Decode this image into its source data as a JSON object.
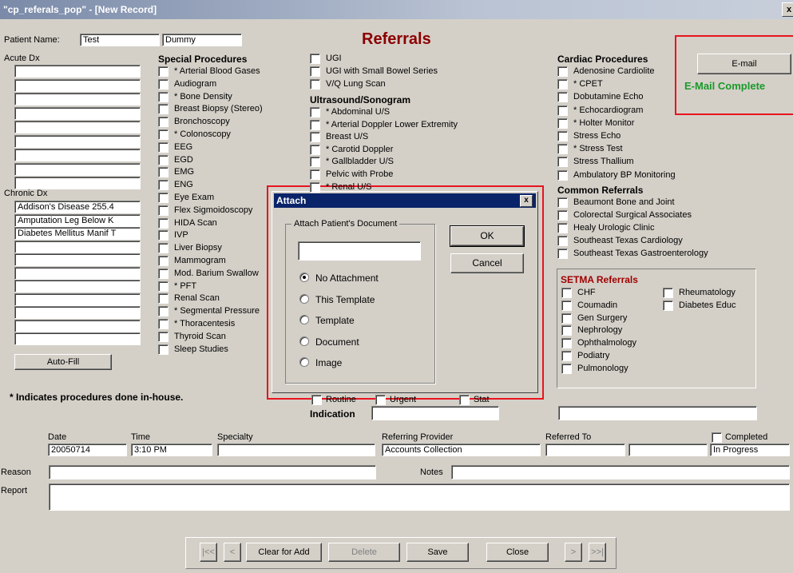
{
  "window": {
    "title": "\"cp_referals_pop\" - [New Record]",
    "close_glyph": "x"
  },
  "form_title": "Referrals",
  "patient": {
    "label": "Patient Name:",
    "first": "Test",
    "last": "Dummy"
  },
  "acute_dx": {
    "label": "Acute Dx",
    "values": [
      "",
      "",
      "",
      "",
      "",
      "",
      "",
      "",
      ""
    ]
  },
  "chronic_dx": {
    "label": "Chronic Dx",
    "values": [
      "Addison's Disease  255.4",
      "Amputation Leg Below K",
      "Diabetes Mellitus Manif T",
      "",
      "",
      "",
      "",
      "",
      "",
      "",
      ""
    ]
  },
  "autofill_label": "Auto-Fill",
  "inhouse_note": "* Indicates procedures done in-house.",
  "special_procedures": {
    "title": "Special Procedures",
    "items": [
      "* Arterial Blood Gases",
      "Audiogram",
      "* Bone Density",
      "Breast Biopsy (Stereo)",
      "Bronchoscopy",
      "* Colonoscopy",
      "EEG",
      "EGD",
      "EMG",
      "ENG",
      "Eye Exam",
      "Flex Sigmoidoscopy",
      "HIDA Scan",
      "IVP",
      "Liver Biopsy",
      "Mammogram",
      "Mod. Barium Swallow",
      "* PFT",
      "Renal Scan",
      "* Segmental Pressure",
      "* Thoracentesis",
      "Thyroid Scan",
      "Sleep Studies"
    ]
  },
  "gi": {
    "items": [
      "UGI",
      "UGI with Small Bowel Series",
      "V/Q Lung Scan"
    ]
  },
  "ultrasound": {
    "title": "Ultrasound/Sonogram",
    "items": [
      "* Abdominal U/S",
      "* Arterial Doppler Lower Extremity",
      "Breast U/S",
      "* Carotid Doppler",
      "* Gallbladder U/S",
      "Pelvic with Probe",
      "* Renal U/S"
    ]
  },
  "cardiac": {
    "title": "Cardiac Procedures",
    "items": [
      "Adenosine Cardiolite",
      "* CPET",
      "Dobutamine Echo",
      "* Echocardiogram",
      "* Holter Monitor",
      "Stress Echo",
      "* Stress Test",
      "Stress Thallium",
      "Ambulatory BP Monitoring"
    ]
  },
  "common": {
    "title": "Common Referrals",
    "items": [
      "Beaumont Bone and Joint",
      "Colorectal Surgical Associates",
      "Healy Urologic Clinic",
      "Southeast Texas Cardiology",
      "Southeast Texas Gastroenterology"
    ]
  },
  "setma": {
    "title": "SETMA Referrals",
    "left": [
      "CHF",
      "Coumadin",
      "Gen Surgery",
      "Nephrology",
      "Ophthalmology",
      "Podiatry",
      "Pulmonology"
    ],
    "right": [
      "Rheumatology",
      "Diabetes Educ"
    ]
  },
  "email": {
    "button": "E-mail",
    "status": "E-Mail Complete"
  },
  "priority": {
    "items": [
      "Routine",
      "Urgent",
      "Stat"
    ]
  },
  "indication": {
    "label": "Indication",
    "value": "",
    "extra_value": ""
  },
  "record": {
    "date_label": "Date",
    "date": "20050714",
    "time_label": "Time",
    "time": "3:10 PM",
    "specialty_label": "Specialty",
    "specialty": "",
    "provider_label": "Referring Provider",
    "provider": "Accounts Collection",
    "referred_label": "Referred To",
    "referred": "",
    "referred2": "",
    "completed_label": "Completed",
    "status": "In Progress",
    "reason_label": "Reason",
    "reason": "",
    "notes_label": "Notes",
    "notes": "",
    "report_label": "Report",
    "report": ""
  },
  "nav": {
    "first": "|<<",
    "prev": "<",
    "clear": "Clear for Add",
    "delete": "Delete",
    "save": "Save",
    "close": "Close",
    "next": ">",
    "last": ">>|"
  },
  "dialog": {
    "title": "Attach",
    "close_glyph": "x",
    "group": "Attach Patient's Document",
    "input": "",
    "ok": "OK",
    "cancel": "Cancel",
    "options": [
      "No Attachment",
      "This Template",
      "Template",
      "Document",
      "Image"
    ],
    "selected": 0
  },
  "colors": {
    "title_red": "#8b0000",
    "email_green": "#1a9a2a",
    "highlight": "#e8141e",
    "setma_red": "#a00000"
  }
}
